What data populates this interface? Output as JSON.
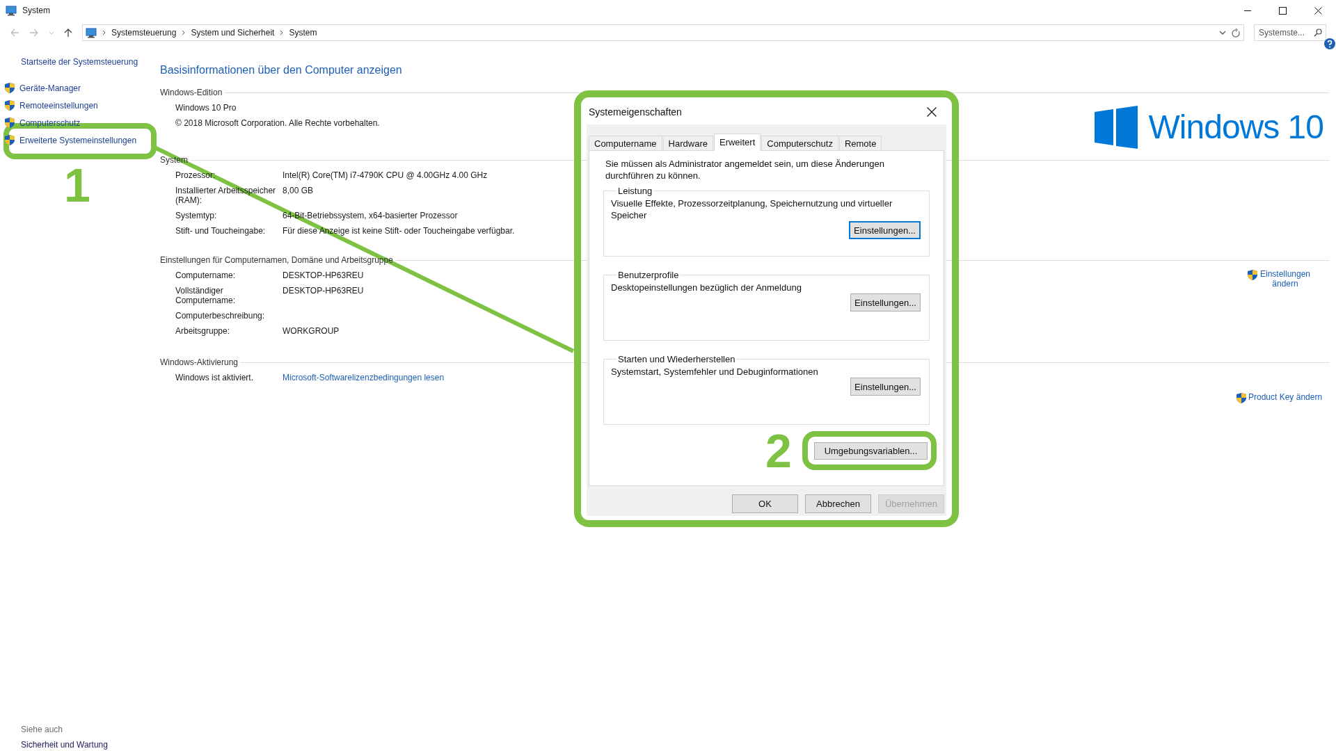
{
  "window": {
    "title": "System"
  },
  "address_bar": {
    "breadcrumbs": [
      "Systemsteuerung",
      "System und Sicherheit",
      "System"
    ]
  },
  "search": {
    "placeholder": "Systemste..."
  },
  "sidebar": {
    "home_link": "Startseite der Systemsteuerung",
    "items": [
      {
        "label": "Geräte-Manager"
      },
      {
        "label": "Remoteeinstellungen"
      },
      {
        "label": "Computerschutz"
      },
      {
        "label": "Erweiterte Systemeinstellungen"
      }
    ],
    "see_also": {
      "heading": "Siehe auch",
      "links": [
        "Sicherheit und Wartung"
      ]
    }
  },
  "main": {
    "title": "Basisinformationen über den Computer anzeigen",
    "sections": [
      {
        "heading": "Windows-Edition",
        "lines": [
          "Windows 10 Pro",
          "© 2018 Microsoft Corporation. Alle Rechte vorbehalten."
        ],
        "logo_text": "Windows 10"
      },
      {
        "heading": "System",
        "rows": [
          {
            "label": "Prozessor:",
            "value": "Intel(R) Core(TM) i7-4790K CPU @ 4.00GHz   4.00 GHz"
          },
          {
            "label": "Installierter Arbeitsspeicher (RAM):",
            "value": "8,00 GB"
          },
          {
            "label": "Systemtyp:",
            "value": "64-Bit-Betriebssystem, x64-basierter Prozessor"
          },
          {
            "label": "Stift- und Toucheingabe:",
            "value": "Für diese Anzeige ist keine Stift- oder Toucheingabe verfügbar."
          }
        ]
      },
      {
        "heading": "Einstellungen für Computernamen, Domäne und Arbeitsgruppe",
        "rows": [
          {
            "label": "Computername:",
            "value": "DESKTOP-HP63REU"
          },
          {
            "label": "Vollständiger Computername:",
            "value": "DESKTOP-HP63REU"
          },
          {
            "label": "Computerbeschreibung:"
          },
          {
            "label": "Arbeitsgruppe:",
            "value": "WORKGROUP"
          }
        ],
        "action": "Einstellungen ändern"
      },
      {
        "heading": "Windows-Aktivierung",
        "rows": [
          {
            "label": "Windows ist aktiviert.",
            "link": "Microsoft-Softwarelizenzbedingungen lesen"
          }
        ],
        "action": "Product Key ändern"
      }
    ]
  },
  "dialog": {
    "title": "Systemeigenschaften",
    "tabs": [
      {
        "label": "Computername",
        "selected": false
      },
      {
        "label": "Hardware",
        "selected": false
      },
      {
        "label": "Erweitert",
        "selected": true
      },
      {
        "label": "Computerschutz",
        "selected": false
      },
      {
        "label": "Remote",
        "selected": false
      }
    ],
    "notice": "Sie müssen als Administrator angemeldet sein, um diese Änderungen durchführen zu können.",
    "groups": [
      {
        "title": "Leistung",
        "description": "Visuelle Effekte, Prozessorzeitplanung, Speichernutzung und virtueller Speicher",
        "button": "Einstellungen...",
        "focused": true
      },
      {
        "title": "Benutzerprofile",
        "description": "Desktopeinstellungen bezüglich der Anmeldung",
        "button": "Einstellungen...",
        "focused": false
      },
      {
        "title": "Starten und Wiederherstellen",
        "description": "Systemstart, Systemfehler und Debuginformationen",
        "button": "Einstellungen...",
        "focused": false
      }
    ],
    "env_button": "Umgebungsvariablen...",
    "footer_buttons": [
      {
        "label": "OK",
        "disabled": false
      },
      {
        "label": "Abbrechen",
        "disabled": false
      },
      {
        "label": "Übernehmen",
        "disabled": true
      }
    ]
  },
  "annotations": [
    {
      "number": "1"
    },
    {
      "number": "2"
    }
  ]
}
